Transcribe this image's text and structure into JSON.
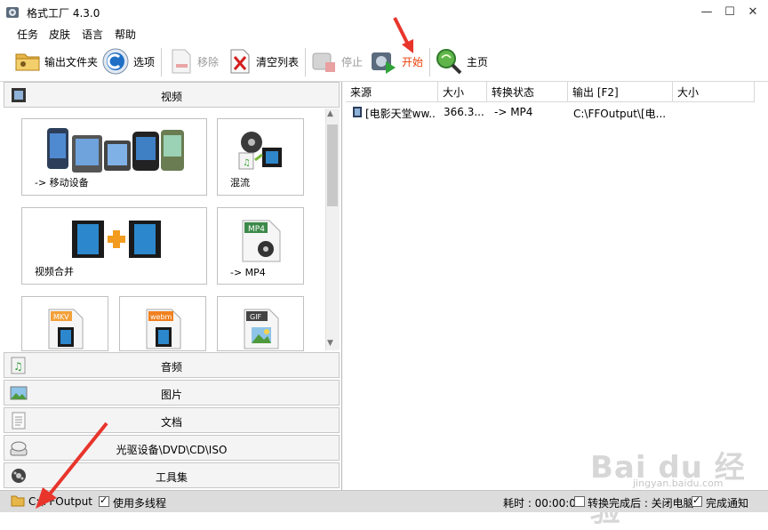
{
  "app": {
    "title": "格式工厂 4.3.0"
  },
  "window_controls": {
    "minimize": "—",
    "maximize": "☐",
    "close": "✕"
  },
  "menu": [
    "任务",
    "皮肤",
    "语言",
    "帮助"
  ],
  "toolbar": {
    "output_folder": "输出文件夹",
    "options": "选项",
    "remove": "移除",
    "clear_list": "清空列表",
    "stop": "停止",
    "start": "开始",
    "home": "主页"
  },
  "categories": {
    "video": "视频",
    "audio": "音频",
    "image": "图片",
    "document": "文档",
    "rom": "光驱设备\\DVD\\CD\\ISO",
    "tools": "工具集"
  },
  "video_tiles": {
    "mobile": "-> 移动设备",
    "mux": "混流",
    "join": "视频合并",
    "mp4": "-> MP4",
    "mkv_badge": "MKV",
    "webm_badge": "webm",
    "gif_badge": "GIF",
    "mp4_badge": "MP4"
  },
  "table": {
    "headers": [
      "来源",
      "大小",
      "转换状态",
      "输出 [F2]",
      "大小"
    ],
    "rows": [
      {
        "source": "[电影天堂ww...",
        "size": "366.3...",
        "status": "-> MP4",
        "output": "C:\\FFOutput\\[电...",
        "out_size": ""
      }
    ]
  },
  "status": {
    "folder": "C:\\FFOutput",
    "multithread": "使用多线程",
    "multithread_checked": true,
    "elapsed": "耗时 : 00:00:00",
    "after_done": "转换完成后 : 关闭电脑",
    "after_done_checked": false,
    "notify": "完成通知",
    "notify_checked": true
  },
  "watermark": {
    "brand": "Bai du 经验",
    "url": "jingyan.baidu.com"
  },
  "colors": {
    "accent_start": "#e8400c",
    "annotation_arrow": "#e8352c"
  }
}
